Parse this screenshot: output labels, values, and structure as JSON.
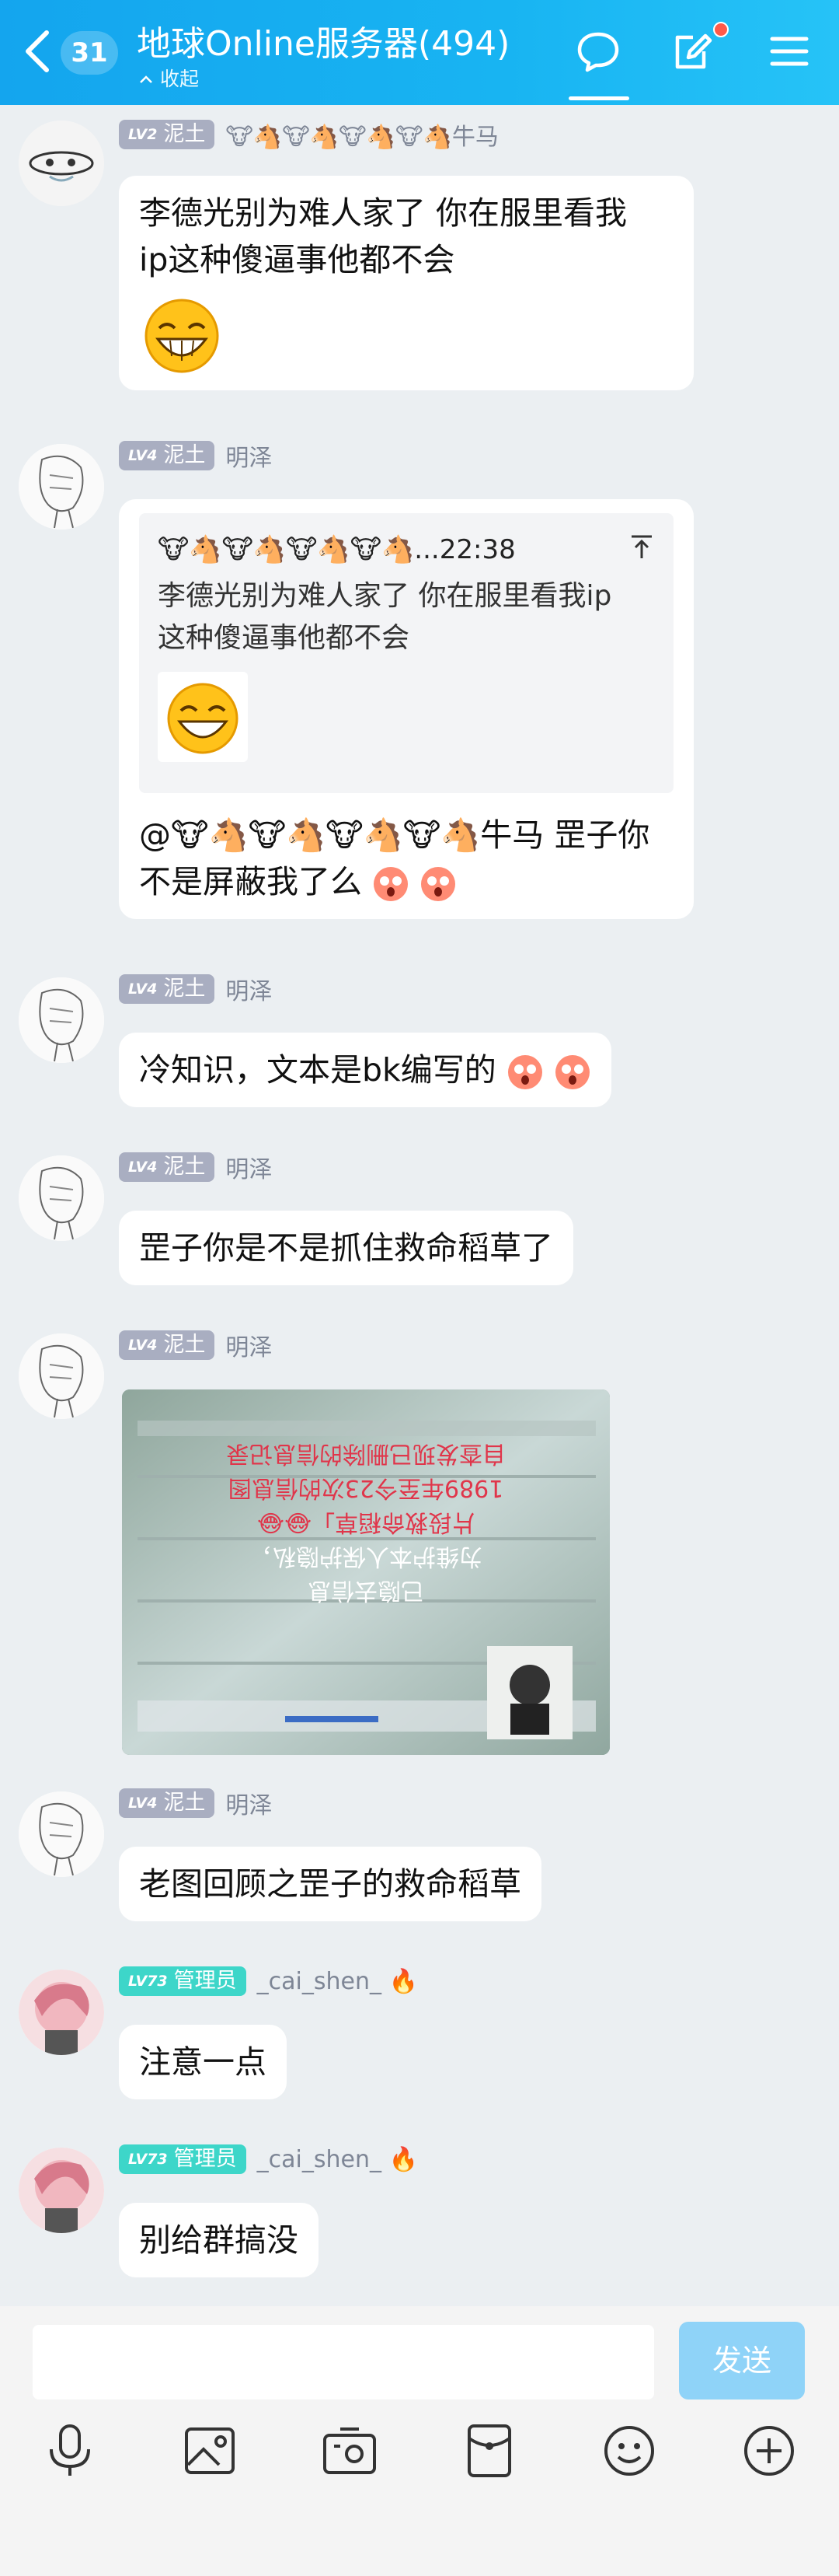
{
  "header": {
    "unread_count": "31",
    "title": "地球Online服务器(494)",
    "collapse_label": "收起"
  },
  "messages": [
    {
      "level": "LV2",
      "role": "泥土",
      "name": "🐮🐴🐮🐴🐮🐴🐮🐴牛马",
      "text_line1": "李德光别为难人家了 你在服里看我",
      "text_line2": "ip这种傻逼事他都不会",
      "emoji": "grin-laugh-emoji"
    },
    {
      "level": "LV4",
      "role": "泥土",
      "name": "明泽",
      "quote_header": "🐮🐴🐮🐴🐮🐴🐮🐴...22:38",
      "quote_line1": "李德光别为难人家了 你在服里看我ip",
      "quote_line2": "这种傻逼事他都不会",
      "text_line1": "@🐮🐴🐮🐴🐮🐴🐮🐴牛马 罡子你",
      "text_line2": "不是屏蔽我了么"
    },
    {
      "level": "LV4",
      "role": "泥土",
      "name": "明泽",
      "text": "冷知识，文本是bk编写的"
    },
    {
      "level": "LV4",
      "role": "泥土",
      "name": "明泽",
      "text": "罡子你是不是抓住救命稻草了"
    },
    {
      "level": "LV4",
      "role": "泥土",
      "name": "明泽",
      "image_caption_lines": [
        "已隐去信息",
        "为维护本人保护隐私，",
        "片段救命稻草」😂😂",
        "1989年至今23次的信息图",
        "自查发现已删除的信息记录"
      ]
    },
    {
      "level": "LV4",
      "role": "泥土",
      "name": "明泽",
      "text": "老图回顾之罡子的救命稻草"
    },
    {
      "level": "LV73",
      "role": "管理员",
      "name": "_cai_shen_ 🔥",
      "text": "注意一点"
    },
    {
      "level": "LV73",
      "role": "管理员",
      "name": "_cai_shen_ 🔥",
      "text": "别给群搞没"
    }
  ],
  "composer": {
    "placeholder": "",
    "send_label": "发送"
  },
  "colors": {
    "header_blue": "#18b4f2",
    "send_button": "#8fd3f8",
    "level_gray": "#a9aec1",
    "level_teal": "#3dd6c9",
    "chat_bg": "#ebeff2"
  }
}
